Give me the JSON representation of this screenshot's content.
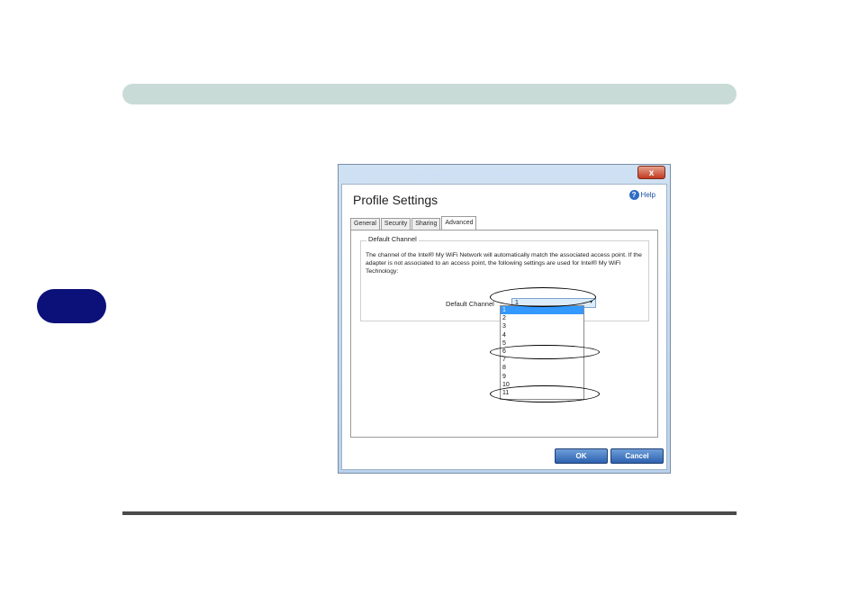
{
  "dialog": {
    "close_glyph": "x",
    "title": "Profile Settings",
    "help_label": "Help",
    "help_glyph": "?",
    "tabs": [
      "General",
      "Security",
      "Sharing",
      "Advanced"
    ],
    "active_tab": "Advanced",
    "group_title": "Default Channel",
    "description": "The channel of the Intel® My WiFi Network will automatically match the associated access point. If the adapter is not associated to an access point, the following settings are used for Intel® My WiFi Technology:",
    "channel_label": "Default Channel",
    "channel_value": "1",
    "chevron_glyph": "▾",
    "channel_options": [
      "1",
      "2",
      "3",
      "4",
      "5",
      "6",
      "7",
      "8",
      "9",
      "10",
      "11"
    ],
    "selected_option": "1",
    "ok_label": "OK",
    "cancel_label": "Cancel"
  },
  "colors": {
    "header_bar": "#c9dbd6",
    "side_tab": "#0c1179",
    "selection": "#3399ff"
  },
  "annotations": [
    "Default Channel select",
    "channel 6",
    "channel 11"
  ]
}
